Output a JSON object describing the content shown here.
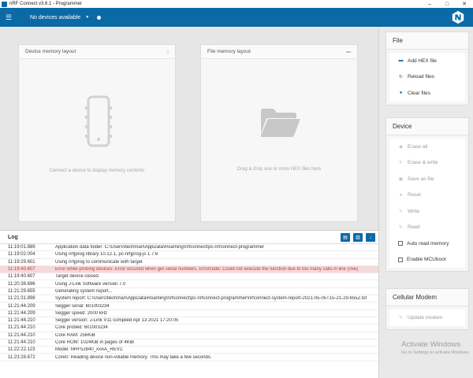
{
  "window": {
    "title": "nRF Connect v3.6.1 - Programmer",
    "controls": {
      "minimize": "–",
      "maximize": "□",
      "close": "✕"
    }
  },
  "appbar": {
    "menu_icon": "hamburger-menu-icon",
    "device_select": "No devices available",
    "caret": "▼",
    "colors": {
      "background": "#0b6aa6"
    }
  },
  "device_memory": {
    "title": "Device memory layout",
    "caption": "Connect a device to display memory contents",
    "icon": "chip-icon"
  },
  "file_memory": {
    "title": "File memory layout",
    "caption": "Drag & drop one or more HEX files here",
    "icon": "folder-icon"
  },
  "log": {
    "title": "Log",
    "buttons": [
      "open-log-folder-icon",
      "clear-log-icon",
      "autoscroll-icon"
    ],
    "rows": [
      {
        "time": "11:19:01.889",
        "text": "Application data folder: C:\\Users\\tlechman\\AppData\\Roaming\\nrfconnect\\pc-nrfconnect-programmer",
        "error": false
      },
      {
        "time": "11:19:02.004",
        "text": "Using nrfjprog library 10.12.1, pc-nrfjprog-js 1.7.6",
        "error": false
      },
      {
        "time": "11:19:29.601",
        "text": "Using nrfjprog to communicate with target",
        "error": false
      },
      {
        "time": "11:19:40.607",
        "text": "Error while probing devices: Error occured when get serial numbers. Errorcode: Could not execute the function due to too many calls in line (0xe)",
        "error": true
      },
      {
        "time": "11:19:40.607",
        "text": "Target device closed.",
        "error": false
      },
      {
        "time": "11:20:38.696",
        "text": "Using J-Link Software version 7.0",
        "error": false
      },
      {
        "time": "11:21:29.655",
        "text": "Generating system report...",
        "error": false
      },
      {
        "time": "11:21:31.898",
        "text": "System report: C:\\Users\\tlechman\\AppData\\Roaming\\nrfconnect\\pc-nrfconnect-programmer\\nrfconnect-system-report-2021-05-05T15-21-29.655Z.txt",
        "error": false
      },
      {
        "time": "11:21:44.209",
        "text": "Segger serial: 601003234",
        "error": false
      },
      {
        "time": "11:21:44.209",
        "text": "Segger speed: 2000 kHz",
        "error": false
      },
      {
        "time": "11:21:44.210",
        "text": "Segger version: J-Link V11 compiled Apr 13 2021 17:20:05",
        "error": false
      },
      {
        "time": "11:21:44.210",
        "text": "Core probed: 601003234",
        "error": false
      },
      {
        "time": "11:21:44.210",
        "text": "Core RAM: 256KiB",
        "error": false
      },
      {
        "time": "11:21:44.210",
        "text": "Core ROM: 1024KiB in pages of 4KiB",
        "error": false
      },
      {
        "time": "11:22:22.123",
        "text": "Model: NRF52840_xxAA_REV2.",
        "error": false
      },
      {
        "time": "11:23:28.672",
        "text": "Core0: Reading device non-volatile memory. This may take a few seconds.",
        "error": false
      }
    ]
  },
  "sidebar": {
    "file": {
      "title": "File",
      "items": [
        {
          "label": "Add HEX file",
          "icon": "folder-open-icon",
          "glyph": "▬"
        },
        {
          "label": "Reload files",
          "icon": "refresh-icon",
          "glyph": "↻"
        },
        {
          "label": "Clear files",
          "icon": "minus-circle-icon",
          "glyph": "●"
        }
      ]
    },
    "device": {
      "title": "Device",
      "items": [
        {
          "label": "Erase all",
          "icon": "eraser-icon",
          "glyph": "◆",
          "type": "button"
        },
        {
          "label": "Erase & write",
          "icon": "pencil-icon",
          "glyph": "✎",
          "type": "button"
        },
        {
          "label": "Save as file",
          "icon": "save-icon",
          "glyph": "▣",
          "type": "button"
        },
        {
          "label": "Reset",
          "icon": "reset-icon",
          "glyph": "●",
          "type": "button"
        },
        {
          "label": "Write",
          "icon": "pencil-icon",
          "glyph": "✎",
          "type": "button"
        },
        {
          "label": "Read",
          "icon": "refresh-icon",
          "glyph": "↻",
          "type": "button"
        },
        {
          "label": "Auto read memory",
          "icon": "checkbox-icon",
          "type": "checkbox"
        },
        {
          "label": "Enable MCUboot",
          "icon": "checkbox-icon",
          "type": "checkbox"
        }
      ]
    },
    "cellular": {
      "title": "Cellular Modem",
      "items": [
        {
          "label": "Update modem",
          "icon": "pencil-icon",
          "glyph": "✎"
        }
      ]
    }
  },
  "watermark": {
    "line1": "Activate Windows",
    "line2": "Go to Settings to activate Windows."
  }
}
